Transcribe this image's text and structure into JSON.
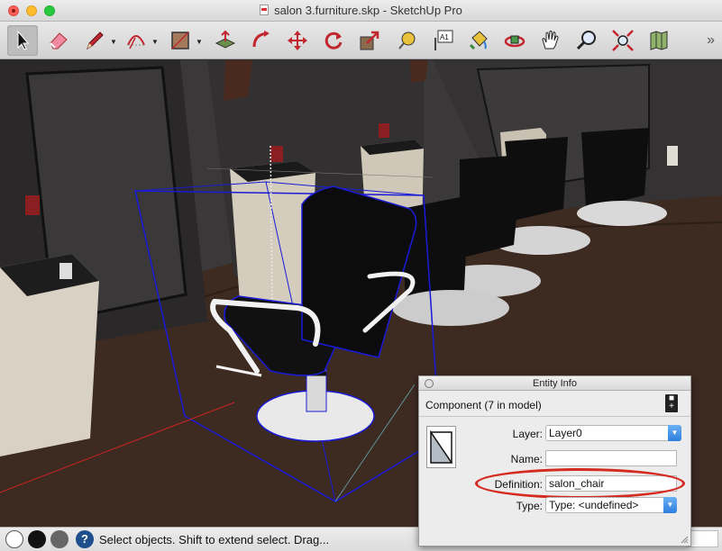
{
  "window": {
    "title": "salon 3.furniture.skp - SketchUp Pro"
  },
  "toolbar": {
    "tools": [
      {
        "name": "select-tool",
        "icon": "arrow-cursor-icon"
      },
      {
        "name": "eraser-tool",
        "icon": "eraser-icon"
      },
      {
        "name": "line-tool",
        "icon": "pencil-icon"
      },
      {
        "name": "arc-tool",
        "icon": "arc-icon"
      },
      {
        "name": "rectangle-tool",
        "icon": "rectangle-icon"
      },
      {
        "name": "push-pull-tool",
        "icon": "push-pull-icon"
      },
      {
        "name": "offset-tool",
        "icon": "offset-icon"
      },
      {
        "name": "move-tool",
        "icon": "move-icon"
      },
      {
        "name": "rotate-tool",
        "icon": "rotate-icon"
      },
      {
        "name": "scale-tool",
        "icon": "scale-icon"
      },
      {
        "name": "tape-measure-tool",
        "icon": "tape-measure-icon"
      },
      {
        "name": "text-tool",
        "icon": "text-icon"
      },
      {
        "name": "paint-bucket-tool",
        "icon": "paint-bucket-icon"
      },
      {
        "name": "orbit-tool",
        "icon": "orbit-icon"
      },
      {
        "name": "pan-tool",
        "icon": "hand-icon"
      },
      {
        "name": "zoom-tool",
        "icon": "magnifier-icon"
      },
      {
        "name": "zoom-extents-tool",
        "icon": "zoom-extents-icon"
      },
      {
        "name": "warehouse-tool",
        "icon": "map-icon"
      }
    ],
    "text_tool_label": "A1",
    "overflow_label": "»"
  },
  "status_bar": {
    "message": "Select objects. Shift to extend select. Drag..."
  },
  "entity_info": {
    "title": "Entity Info",
    "component_label": "Component (7 in model)",
    "toggle_label": "▪▪",
    "layer_label": "Layer:",
    "layer_value": "Layer0",
    "name_label": "Name:",
    "name_value": "",
    "definition_label": "Definition:",
    "definition_value": "salon_chair",
    "type_label": "Type:",
    "type_value": "Type: <undefined>"
  },
  "colors": {
    "highlight_ring": "#d42a20",
    "selection_box": "#1a1ad8",
    "select_arrow": "#2f7ee0"
  }
}
